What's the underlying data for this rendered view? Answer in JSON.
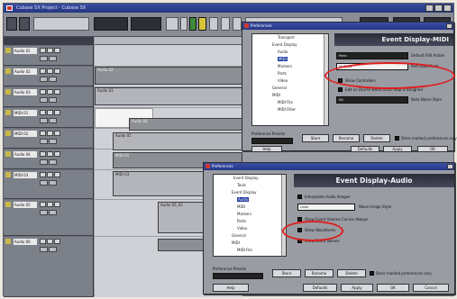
{
  "app": {
    "window_title": "Cubase SX Project - Cubase SX",
    "tracks": [
      {
        "name": "Audio 01"
      },
      {
        "name": "Audio 02"
      },
      {
        "name": "Audio 03"
      },
      {
        "name": "MIDI 01"
      },
      {
        "name": "MIDI 02"
      },
      {
        "name": "Audio 04"
      },
      {
        "name": "MIDI 03"
      },
      {
        "name": "Audio 05"
      },
      {
        "name": "Audio 06"
      }
    ],
    "parts": [
      "Audio 02",
      "Audio 03",
      "Audio 04",
      "Audio 05",
      "MIDI 01",
      "MIDI 03",
      "Audio 05_02"
    ]
  },
  "dialog_midi": {
    "title": "Preferences",
    "panel_title": "Event Display-MIDI",
    "tree": [
      "Transport",
      "Event Display",
      "Audio",
      "MIDI",
      "Markers",
      "Parts",
      "Video",
      "General",
      "MIDI",
      "MIDI File",
      "MIDI Filter"
    ],
    "selected_index": 3,
    "fields": [
      {
        "value": "Parts",
        "label": "Default Edit Action"
      },
      {
        "value": "No Data",
        "label": "Part Data Mode"
      }
    ],
    "options": [
      {
        "label": "Show Controllers"
      },
      {
        "label": "Edit as Drums when Drum Map is assigned"
      },
      {
        "value": "Nil",
        "label": "Note Name Style"
      }
    ],
    "presets_label": "Preference Presets",
    "buttons": {
      "store": "Store",
      "rename": "Rename",
      "delete": "Delete",
      "help": "Help",
      "defaults": "Defaults",
      "apply": "Apply",
      "ok": "OK"
    },
    "marked_only": "Store marked preferences only"
  },
  "dialog_audio": {
    "title": "Preferences",
    "panel_title": "Event Display-Audio",
    "tree": [
      "Event Display",
      "Tools",
      "Event Display",
      "Audio",
      "MIDI",
      "Markers",
      "Parts",
      "Video",
      "General",
      "MIDI",
      "MIDI File"
    ],
    "selected_index": 3,
    "options": [
      {
        "label": "Interpolate Audio Images"
      },
      {
        "value": "Lines",
        "label": "Wave Image Style"
      },
      {
        "label": "Show Event Volume Curves Always"
      },
      {
        "label": "Show Waveforms"
      },
      {
        "label": "Show Event Names"
      }
    ],
    "presets_label": "Preference Presets",
    "buttons": {
      "store": "Store",
      "rename": "Rename",
      "delete": "Delete",
      "help": "Help",
      "defaults": "Defaults",
      "apply": "Apply",
      "ok": "OK",
      "cancel": "Cancel"
    },
    "marked_only": "Store marked preferences only"
  },
  "colors": {
    "highlight_circle": "#e01e1e",
    "title_bar": "#2a3c92",
    "selected_tree_item": "#1e3aa0"
  }
}
